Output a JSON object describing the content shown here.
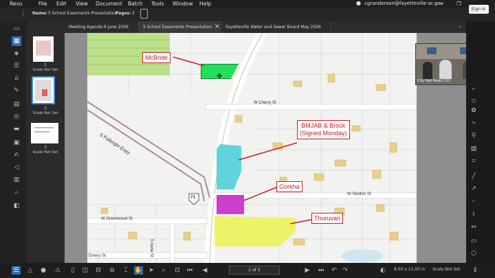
{
  "menu": [
    "Revu",
    "File",
    "Edit",
    "View",
    "Document",
    "Batch",
    "Tools",
    "Window",
    "Help"
  ],
  "account": "cgranderson@fayetteville-ar.gov",
  "sign_in": "Sign In",
  "toolbar": {
    "name_label": "Name:",
    "name_value": "5 School Easements Presentation",
    "pages_label": "Pages:",
    "pages_value": "3"
  },
  "tabs": [
    {
      "label": "Meeting Agenda 9 June 2026"
    },
    {
      "label": "5 School Easements Presentation",
      "close": "×"
    },
    {
      "label": "Fayetteville Water and Sewer Board May 2026"
    }
  ],
  "thumbnails": [
    {
      "number": "1",
      "caption": "Scale Not Set"
    },
    {
      "number": "2",
      "caption": "Scale Not Set"
    },
    {
      "number": "3",
      "caption": "Scale Not Set"
    }
  ],
  "map": {
    "labels": {
      "mcbride": "McBride",
      "bmjab_line1": "BMJAB & Brock",
      "bmjab_line2": "(Signed Monday)",
      "gorkha": "Gorkha",
      "thuruvan": "Thuruvan"
    },
    "streets": {
      "cherry": "W Cherry St",
      "skelton": "W Skelton St",
      "greenwood": "W Greenwood St",
      "fulbright": "S Fulbright Expy",
      "irene": "S Irene St",
      "emery": "Emery St",
      "highway": "71"
    },
    "colors": {
      "mcbride": "#22e05a",
      "bmjab": "#4fd0d8",
      "gorkha": "#cc33cc",
      "thuruvan": "#eef25a",
      "label_red": "#c0202a"
    }
  },
  "video": {
    "caption": "City Hall Room 111"
  },
  "status": {
    "page_indicator": "2 of 3",
    "page_size": "8.50 x 11.00 in",
    "scale": "Scale Not Set"
  }
}
